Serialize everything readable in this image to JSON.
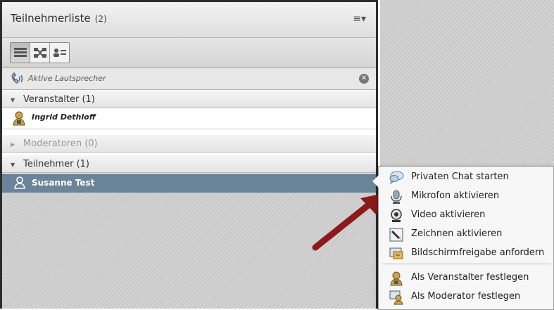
{
  "panel": {
    "title": "Teilnehmerliste",
    "count": "(2)",
    "menu_icon": "list-menu-icon"
  },
  "view_buttons": [
    {
      "name": "list-view",
      "icon": "list-view-icon",
      "active": true
    },
    {
      "name": "breakout-view",
      "icon": "breakout-icon",
      "active": false
    },
    {
      "name": "attendee-view",
      "icon": "attendee-list-icon",
      "active": false
    }
  ],
  "speaker": {
    "label": "Aktive Lautsprecher"
  },
  "groups": {
    "host": "Veranstalter (1)",
    "host_member": "Ingrid Dethloff",
    "presenter": "Moderatoren (0)",
    "participants": "Teilnehmer (1)",
    "participant_member": "Susanne Test"
  },
  "context_menu": {
    "items": [
      {
        "label": "Privaten Chat starten",
        "icon": "chat-bubble-icon"
      },
      {
        "label": "Mikrofon aktivieren",
        "icon": "microphone-icon"
      },
      {
        "label": "Video aktivieren",
        "icon": "webcam-icon"
      },
      {
        "label": "Zeichnen aktivieren",
        "icon": "pencil-draw-icon"
      },
      {
        "label": "Bildschirmfreigabe anfordern",
        "icon": "screen-share-icon"
      },
      {
        "label": "Als Veranstalter festlegen",
        "icon": "host-user-icon"
      },
      {
        "label": "Als Moderator festlegen",
        "icon": "presenter-user-icon"
      }
    ]
  },
  "colors": {
    "selected_row": "#6b8499",
    "arrow": "#8b1a1a"
  }
}
